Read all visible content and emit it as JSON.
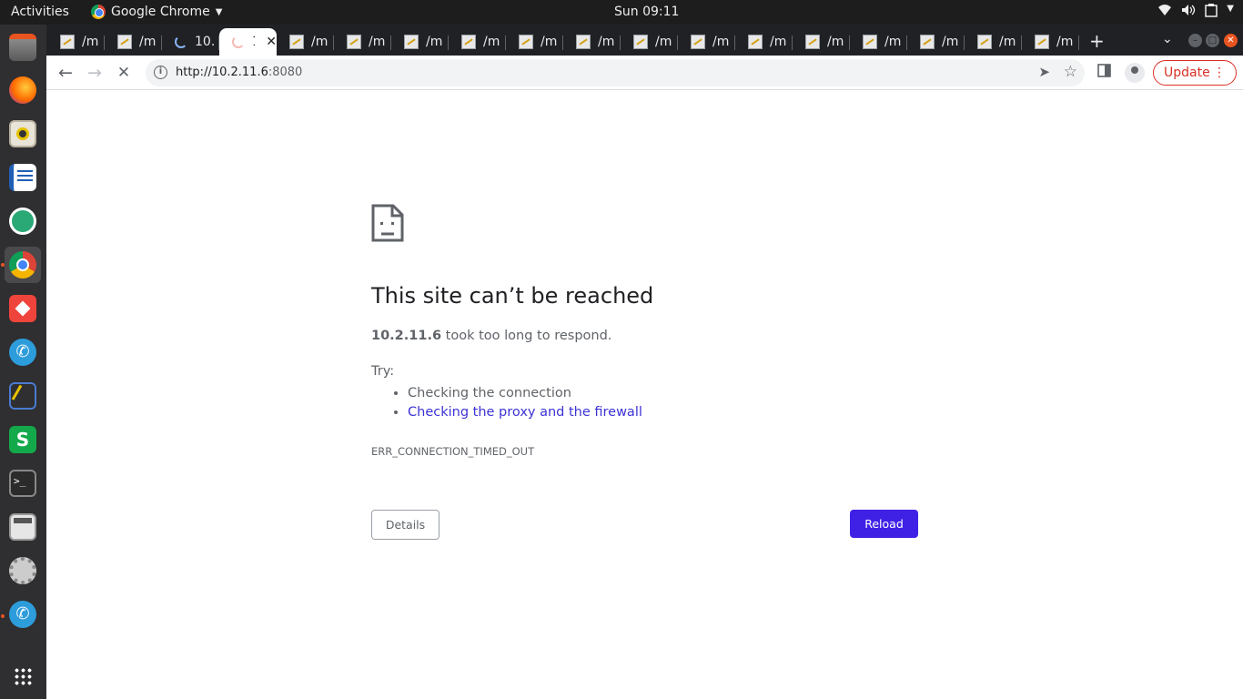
{
  "topbar": {
    "activities": "Activities",
    "app_name": "Google Chrome",
    "clock": "Sun 09:11"
  },
  "tabs": [
    {
      "title": "/m",
      "kind": "favicon"
    },
    {
      "title": "/m",
      "kind": "favicon"
    },
    {
      "title": "10.",
      "kind": "loading"
    },
    {
      "title": "1",
      "kind": "loading-active"
    },
    {
      "title": "/m",
      "kind": "favicon"
    },
    {
      "title": "/m",
      "kind": "favicon"
    },
    {
      "title": "/m",
      "kind": "favicon"
    },
    {
      "title": "/m",
      "kind": "favicon"
    },
    {
      "title": "/m",
      "kind": "favicon"
    },
    {
      "title": "/m",
      "kind": "favicon"
    },
    {
      "title": "/m",
      "kind": "favicon"
    },
    {
      "title": "/m",
      "kind": "favicon"
    },
    {
      "title": "/m",
      "kind": "favicon"
    },
    {
      "title": "/m",
      "kind": "favicon"
    },
    {
      "title": "/m",
      "kind": "favicon"
    },
    {
      "title": "/m",
      "kind": "favicon"
    },
    {
      "title": "/m",
      "kind": "favicon"
    },
    {
      "title": "/m",
      "kind": "favicon"
    }
  ],
  "omnibox": {
    "url_host": "http://10.2.11.6",
    "url_port": ":8080"
  },
  "update_label": "Update",
  "error": {
    "title": "This site can’t be reached",
    "host": "10.2.11.6",
    "message_suffix": " took too long to respond.",
    "try_label": "Try:",
    "tip_1": "Checking the connection",
    "tip_2_link": "Checking the proxy and the firewall",
    "code": "ERR_CONNECTION_TIMED_OUT",
    "details_label": "Details",
    "reload_label": "Reload"
  },
  "colors": {
    "reload_button": "#3f21e6",
    "link": "#3c32d6",
    "update_red": "#d93025",
    "dock_bg": "#2f2e30",
    "topbar_bg": "#1d1d1d"
  },
  "dock_icons": [
    "files-icon",
    "firefox-icon",
    "rhythmbox-icon",
    "writer-icon",
    "remote-desktop-icon",
    "chrome-icon",
    "anydesk-icon",
    "phone-icon",
    "network-tool-icon",
    "sheets-icon",
    "terminal-icon",
    "calculator-icon",
    "settings-tool-icon",
    "phone-icon-2",
    "app-grid-icon"
  ]
}
